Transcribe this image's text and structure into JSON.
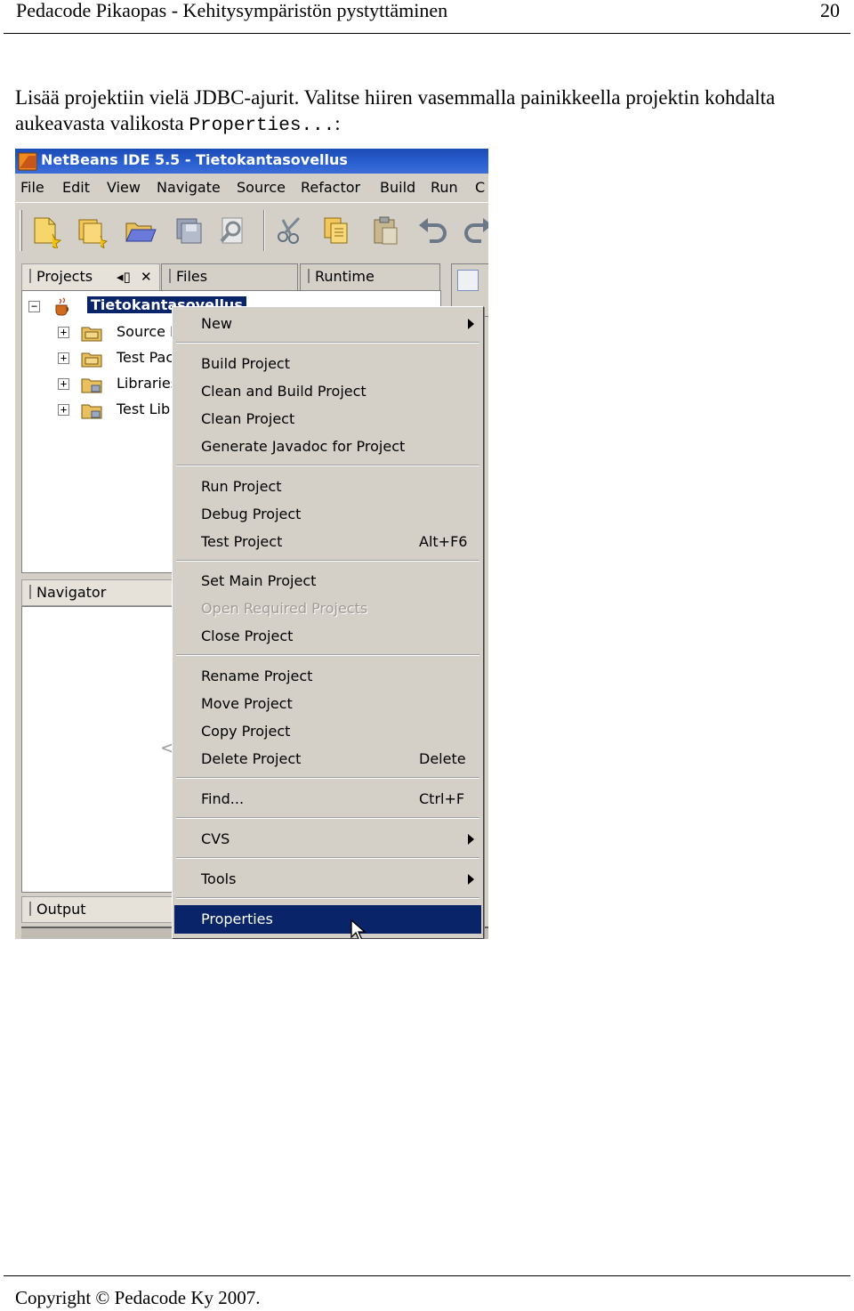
{
  "doc": {
    "header_title": "Pedacode Pikaopas - Kehitysympäristön pystyttäminen",
    "page_number": "20",
    "paragraph_before": "Lisää projektiin vielä JDBC-ajurit. Valitse hiiren vasemmalla painikkeella projektin kohdalta aukeavasta valikosta ",
    "paragraph_code": "Properties...",
    "paragraph_after": ":",
    "footer": "Copyright © Pedacode Ky 2007."
  },
  "ide": {
    "window_title": "NetBeans IDE 5.5 - Tietokantasovellus",
    "menubar": [
      "File",
      "Edit",
      "View",
      "Navigate",
      "Source",
      "Refactor",
      "Build",
      "Run",
      "C"
    ],
    "toolbar_icons": [
      "new-file-icon",
      "new-project-icon",
      "open-project-icon",
      "save-all-icon",
      "find-icon",
      "cut-icon",
      "copy-icon",
      "paste-icon",
      "undo-icon",
      "redo-icon"
    ],
    "tabs": {
      "projects": "Projects",
      "files": "Files",
      "runtime": "Runtime",
      "navigator": "Navigator",
      "output": "Output"
    },
    "tree": {
      "root": "Tietokantasovellus",
      "children": [
        "Source P",
        "Test Pac",
        "Libraries",
        "Test Lib"
      ]
    },
    "navigator_hint": "<",
    "context_menu": {
      "new": "New",
      "build_project": "Build Project",
      "clean_build_project": "Clean and Build Project",
      "clean_project": "Clean Project",
      "generate_javadoc": "Generate Javadoc for Project",
      "run_project": "Run Project",
      "debug_project": "Debug Project",
      "test_project": "Test Project",
      "test_project_accel": "Alt+F6",
      "set_main_project": "Set Main Project",
      "open_required_projects": "Open Required Projects",
      "close_project": "Close Project",
      "rename_project": "Rename Project",
      "move_project": "Move Project",
      "copy_project": "Copy Project",
      "delete_project": "Delete Project",
      "delete_project_accel": "Delete",
      "find": "Find...",
      "find_accel": "Ctrl+F",
      "cvs": "CVS",
      "tools": "Tools",
      "properties": "Properties"
    },
    "colors": {
      "title_bar": "#2a5fd0",
      "selection": "#0a246a",
      "chrome": "#d4d0c8"
    }
  }
}
